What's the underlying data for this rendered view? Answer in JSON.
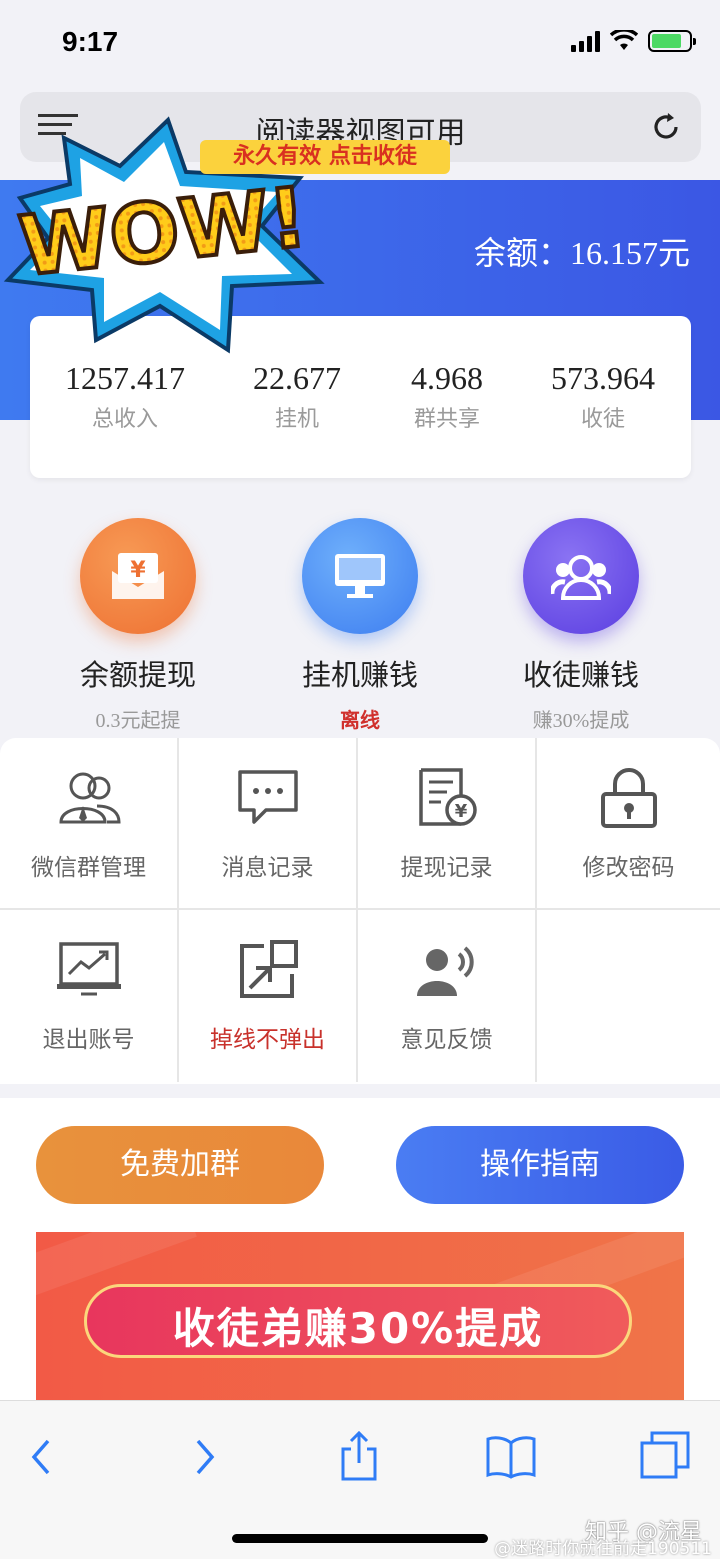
{
  "status_bar": {
    "time": "9:17"
  },
  "address_bar": {
    "title": "阅读器视图可用"
  },
  "header": {
    "balance": "余额：16.157元"
  },
  "stats": [
    {
      "value": "1257.417",
      "label": "总收入"
    },
    {
      "value": "22.677",
      "label": "挂机"
    },
    {
      "value": "4.968",
      "label": "群共享"
    },
    {
      "value": "573.964",
      "label": "收徒"
    }
  ],
  "sticker": {
    "text": "WOW!"
  },
  "features": [
    {
      "title": "余额提现",
      "sub": "0.3元起提",
      "icon": "yen-envelope-icon",
      "color": "#f07b3a"
    },
    {
      "title": "挂机赚钱",
      "sub": "离线",
      "icon": "monitor-icon",
      "color": "#4a8ef5"
    },
    {
      "title": "收徒赚钱",
      "sub": "赚30%提成",
      "icon": "users-icon",
      "color": "#6d55e8"
    }
  ],
  "grid": [
    {
      "label": "微信群管理",
      "icon": "group-icon"
    },
    {
      "label": "消息记录",
      "icon": "message-icon"
    },
    {
      "label": "提现记录",
      "icon": "withdraw-record-icon"
    },
    {
      "label": "修改密码",
      "icon": "lock-icon"
    },
    {
      "label": "退出账号",
      "icon": "chart-monitor-icon"
    },
    {
      "label": "掉线不弹出",
      "icon": "external-link-icon"
    },
    {
      "label": "意见反馈",
      "icon": "feedback-icon"
    }
  ],
  "buttons": {
    "join_group": "免费加群",
    "guide": "操作指南"
  },
  "banner": {
    "title": "收徒弟赚30%提成",
    "subtitle": "永久有效 点击收徒"
  },
  "toolbar": {
    "icons": [
      "back-icon",
      "forward-icon",
      "share-icon",
      "bookmarks-icon",
      "tabs-icon"
    ]
  },
  "watermark": {
    "zhihu": "知乎 @流星",
    "weibo": "@迷路时你就往前走190511"
  },
  "colors": {
    "header_blue": "#3f7af0",
    "orange": "#e8923c",
    "red_text": "#c8312b"
  }
}
